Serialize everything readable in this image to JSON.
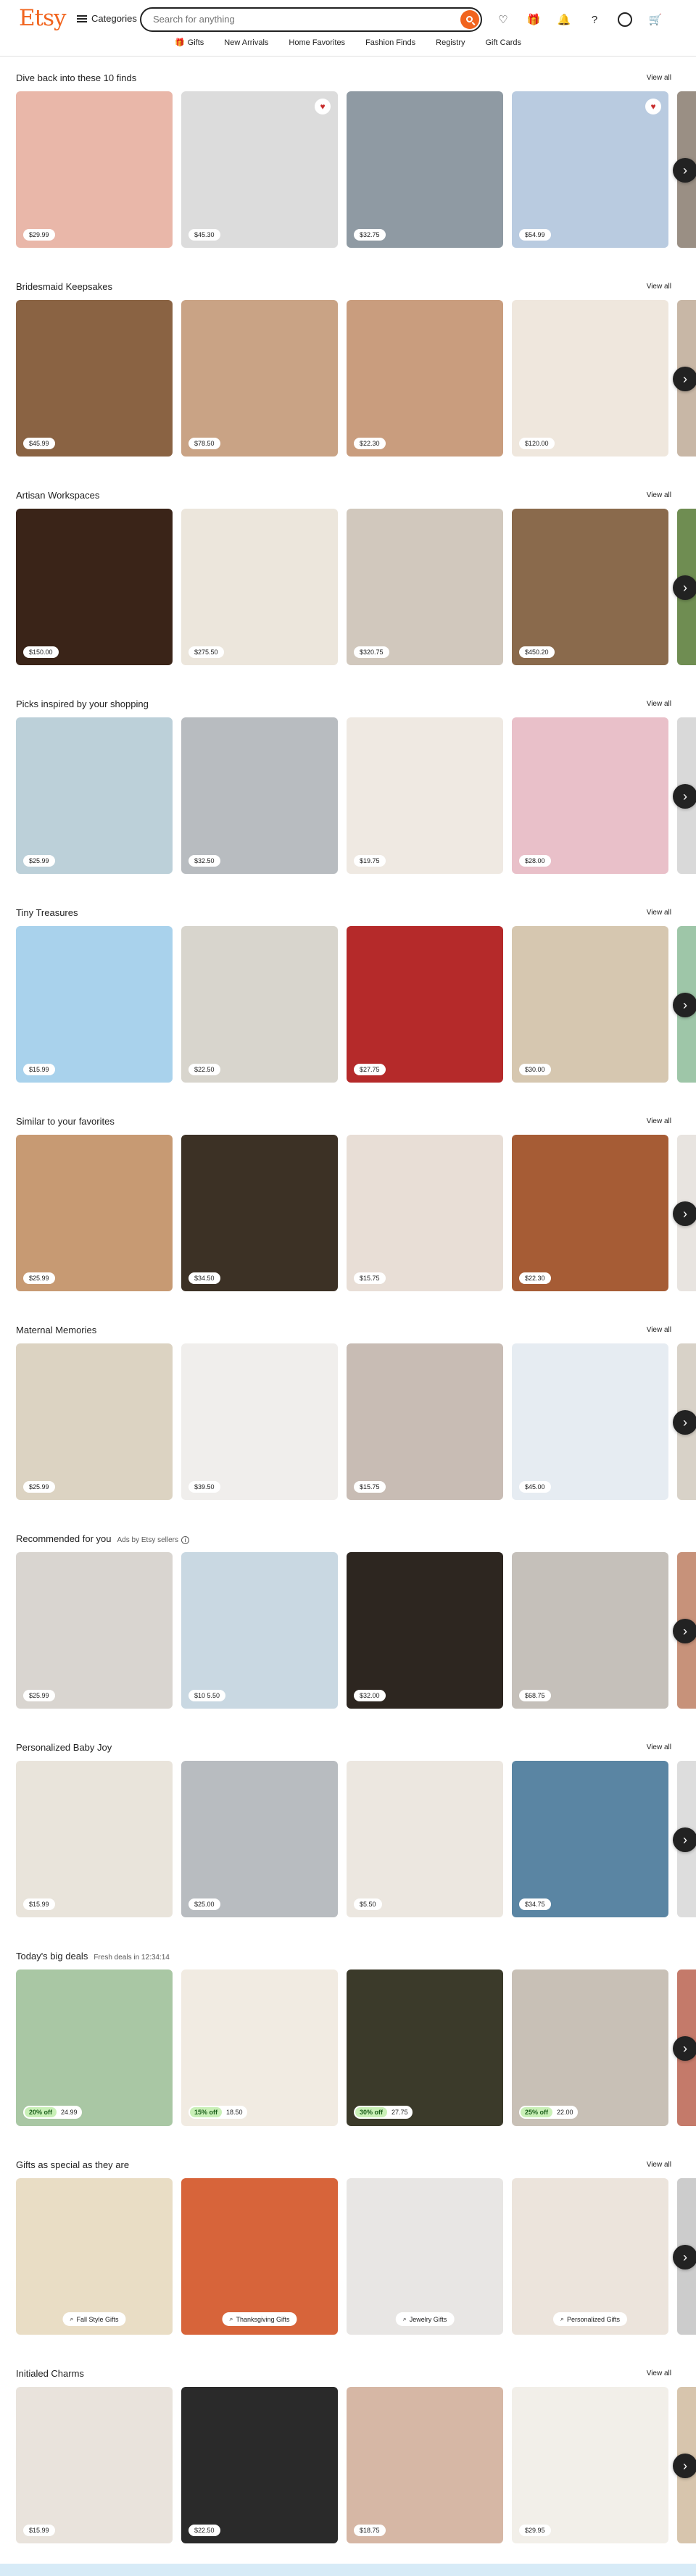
{
  "header": {
    "logo": "Etsy",
    "categories_label": "Categories",
    "search_placeholder": "Search for anything",
    "nav": [
      "Gifts",
      "New Arrivals",
      "Home Favorites",
      "Fashion Finds",
      "Registry",
      "Gift Cards"
    ]
  },
  "sections": [
    {
      "title": "Dive back into these 10 finds",
      "view_all": "View all",
      "prices": [
        "$29.99",
        "$45.30",
        "$32.75",
        "$54.99"
      ],
      "colors": [
        "#e9b7a9",
        "#dcdcdc",
        "#8f9aa3",
        "#b9cbe0",
        "#9a8f84"
      ],
      "hearts": [
        false,
        true,
        false,
        true
      ]
    },
    {
      "title": "Bridesmaid Keepsakes",
      "view_all": "View all",
      "prices": [
        "$45.99",
        "$78.50",
        "$22.30",
        "$120.00"
      ],
      "colors": [
        "#8a6343",
        "#c9a385",
        "#c99d7e",
        "#efe7dd",
        "#c8b7a6"
      ]
    },
    {
      "title": "Artisan Workspaces",
      "view_all": "View all",
      "prices": [
        "$150.00",
        "$275.50",
        "$320.75",
        "$450.20"
      ],
      "colors": [
        "#3a2418",
        "#ece6dc",
        "#d1c8bd",
        "#8a6a4c",
        "#6f8d52"
      ]
    },
    {
      "title": "Picks inspired by your shopping",
      "view_all": "View all",
      "prices": [
        "$25.99",
        "$32.50",
        "$19.75",
        "$28.00"
      ],
      "colors": [
        "#bcd0d9",
        "#b8bcc0",
        "#efe9e2",
        "#e9c0c9",
        "#d9d9d9"
      ]
    },
    {
      "title": "Tiny Treasures",
      "view_all": "View all",
      "prices": [
        "$15.99",
        "$22.50",
        "$27.75",
        "$30.00"
      ],
      "colors": [
        "#a9d2ec",
        "#d8d5cd",
        "#b52a2a",
        "#d6c7b0",
        "#9ec6a8"
      ]
    },
    {
      "title": "Similar to your favorites",
      "view_all": "View all",
      "prices": [
        "$25.99",
        "$34.50",
        "$15.75",
        "$22.30"
      ],
      "colors": [
        "#c79a73",
        "#3c3125",
        "#e8ded6",
        "#a65c35",
        "#e8e4e0"
      ]
    },
    {
      "title": "Maternal Memories",
      "view_all": "View all",
      "prices": [
        "$25.99",
        "$39.50",
        "$15.75",
        "$45.00"
      ],
      "colors": [
        "#dcd3c2",
        "#f0eeec",
        "#c8bcb4",
        "#e6ecf2",
        "#d8d2c8"
      ]
    },
    {
      "title": "Recommended for you",
      "subtitle": "Ads by Etsy sellers",
      "view_all": "",
      "prices": [
        "$25.99",
        "$10 5.50",
        "$32.00",
        "$68.75"
      ],
      "colors": [
        "#d9d5d0",
        "#c9d8e2",
        "#2d2620",
        "#c5c0ba",
        "#c7927a"
      ]
    },
    {
      "title": "Personalized Baby Joy",
      "view_all": "View all",
      "prices": [
        "$15.99",
        "$25.00",
        "$5.50",
        "$34.75"
      ],
      "colors": [
        "#e9e4db",
        "#b8bcc0",
        "#ece7e0",
        "#5a85a3",
        "#dddddd"
      ]
    },
    {
      "title": "Today's big deals",
      "subtitle": "Fresh deals in 12:34:14",
      "view_all": "",
      "deals": [
        {
          "off": "20% off",
          "price": "24.99"
        },
        {
          "off": "15% off",
          "price": "18.50"
        },
        {
          "off": "30% off",
          "price": "27.75"
        },
        {
          "off": "25% off",
          "price": "22.00"
        }
      ],
      "colors": [
        "#a9c7a4",
        "#f1ebe2",
        "#3b3a2a",
        "#c8c0b6",
        "#c47a6a"
      ]
    },
    {
      "title": "Gifts as special as they are",
      "view_all": "View all",
      "pills": [
        "Fall Style Gifts",
        "Thanksgiving Gifts",
        "Jewelry Gifts",
        "Personalized Gifts"
      ],
      "colors": [
        "#e9ddc5",
        "#d7643a",
        "#e8e6e4",
        "#ece4dc",
        "#cccccc"
      ]
    },
    {
      "title": "Initialed Charms",
      "view_all": "View all",
      "prices": [
        "$15.99",
        "$22.50",
        "$18.75",
        "$29.95"
      ],
      "colors": [
        "#e9e3dc",
        "#2a2a2a",
        "#d6b7a5",
        "#f2efe9",
        "#d7c5ad"
      ]
    }
  ]
}
